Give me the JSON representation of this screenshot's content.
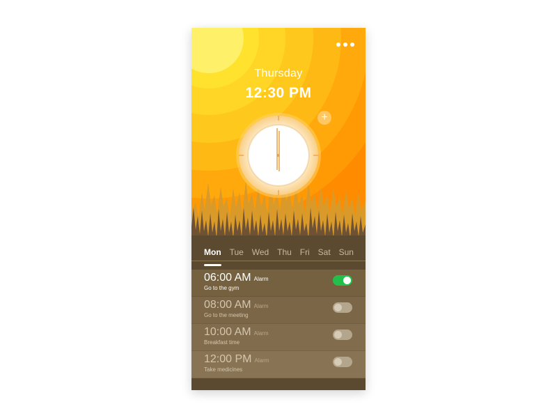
{
  "header": {
    "day": "Thursday",
    "time": "12:30 PM",
    "menu_icon": "more-dots-icon",
    "add_icon": "plus-icon",
    "add_symbol": "+"
  },
  "weekdays": {
    "items": [
      "Mon",
      "Tue",
      "Wed",
      "Thu",
      "Fri",
      "Sat",
      "Sun"
    ],
    "selected": "Mon"
  },
  "alarms": [
    {
      "time": "06:00 AM",
      "label": "Alarm",
      "note": "Go to the gym",
      "enabled": true
    },
    {
      "time": "08:00 AM",
      "label": "Alarm",
      "note": "Go to the meeting",
      "enabled": false
    },
    {
      "time": "10:00 AM",
      "label": "Alarm",
      "note": "Breakfast time",
      "enabled": false
    },
    {
      "time": "12:00 PM",
      "label": "Alarm",
      "note": "Take medicines",
      "enabled": false
    }
  ],
  "colors": {
    "sky_inner": "#ffe24a",
    "sky_outer": "#ff8a00",
    "ground": "#5c4a30",
    "toggle_on": "#22c04a"
  }
}
